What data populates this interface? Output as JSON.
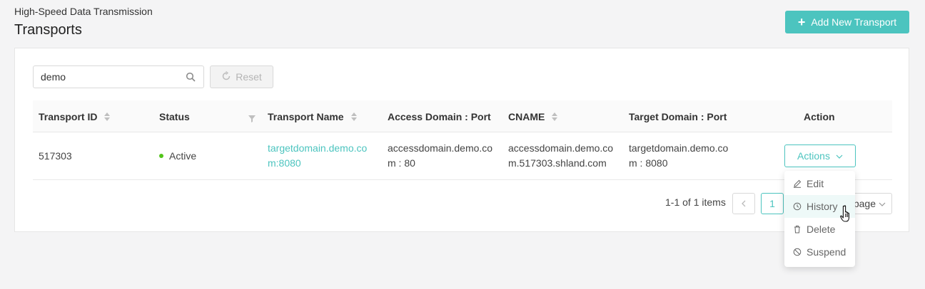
{
  "header": {
    "breadcrumb": "High-Speed Data Transmission",
    "title": "Transports",
    "add_button_label": "Add New Transport"
  },
  "filters": {
    "search_value": "demo",
    "reset_label": "Reset"
  },
  "table": {
    "columns": [
      {
        "label": "Transport ID",
        "sortable": true
      },
      {
        "label": "Status",
        "filterable": true
      },
      {
        "label": "Transport Name",
        "sortable": true
      },
      {
        "label": "Access Domain : Port"
      },
      {
        "label": "CNAME",
        "sortable": true
      },
      {
        "label": "Target Domain : Port"
      },
      {
        "label": "Action"
      }
    ],
    "rows": [
      {
        "transport_id": "517303",
        "status": "Active",
        "transport_name": "targetdomain.demo.com:8080",
        "access_domain_port": "accessdomain.demo.com : 80",
        "cname": "accessdomain.demo.com.517303.shland.com",
        "target_domain_port": "targetdomain.demo.com : 8080",
        "action_label": "Actions"
      }
    ]
  },
  "pagination": {
    "summary": "1-1 of 1 items",
    "current_page": "1",
    "page_size_label": "page"
  },
  "actions_menu": {
    "items": [
      {
        "label": "Edit",
        "icon": "edit-icon"
      },
      {
        "label": "History",
        "icon": "history-icon"
      },
      {
        "label": "Delete",
        "icon": "delete-icon"
      },
      {
        "label": "Suspend",
        "icon": "suspend-icon"
      }
    ],
    "hovered": "History"
  },
  "colors": {
    "accent": "#4cc4bf",
    "status_active": "#52c41a"
  }
}
